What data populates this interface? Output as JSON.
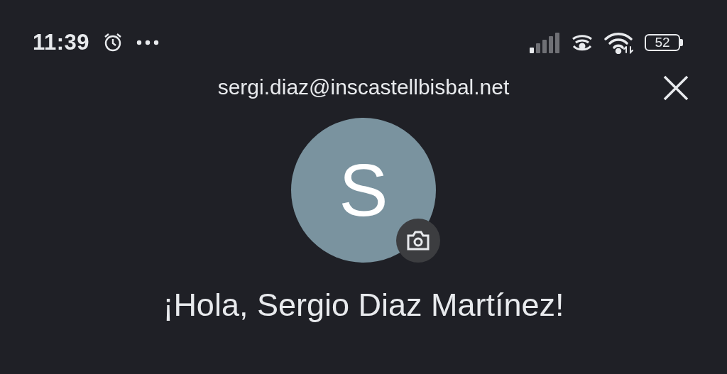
{
  "status_bar": {
    "time": "11:39",
    "battery": "52"
  },
  "account": {
    "email": "sergi.diaz@inscastellbisbal.net",
    "avatar_initial": "S"
  },
  "greeting": "¡Hola, Sergio Diaz Martínez!"
}
